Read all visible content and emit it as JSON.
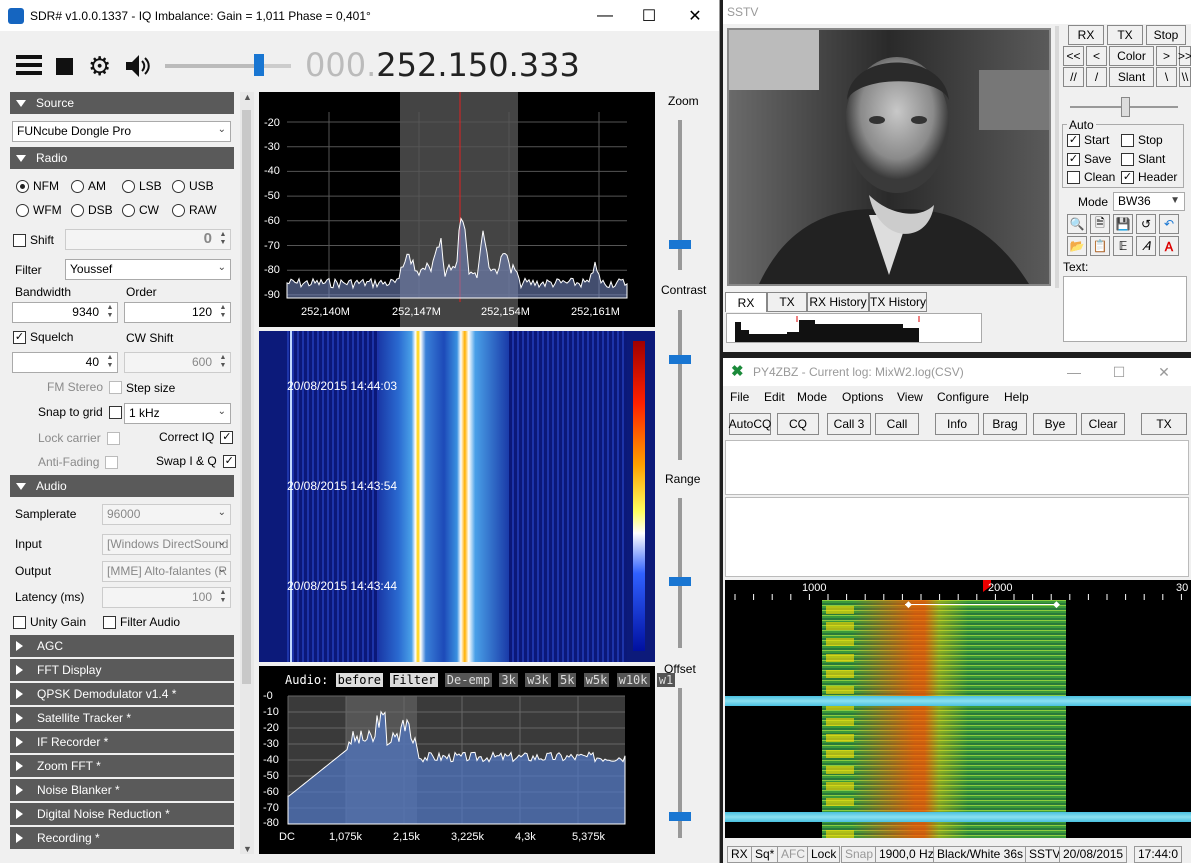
{
  "sdr": {
    "title": "SDR# v1.0.0.1337 - IQ Imbalance: Gain = 1,011 Phase = 0,401°",
    "frequency_dim": "000.",
    "frequency": "252.150.333",
    "source_header": "Source",
    "source_device": "FUNcube Dongle Pro",
    "radio_header": "Radio",
    "modes": [
      "NFM",
      "AM",
      "LSB",
      "USB",
      "WFM",
      "DSB",
      "CW",
      "RAW"
    ],
    "selected_mode": "NFM",
    "shift_label": "Shift",
    "shift_value": "0",
    "filter_label": "Filter",
    "filter_value": "Youssef",
    "bandwidth_label": "Bandwidth",
    "bandwidth_value": "9340",
    "order_label": "Order",
    "order_value": "120",
    "squelch_label": "Squelch",
    "squelch_value": "40",
    "cwshift_label": "CW Shift",
    "cwshift_value": "600",
    "fmstereo_label": "FM Stereo",
    "stepsize_label": "Step size",
    "snap_label": "Snap to grid",
    "step_value": "1 kHz",
    "lock_carrier_label": "Lock carrier",
    "correct_iq_label": "Correct IQ",
    "antifading_label": "Anti-Fading",
    "swap_iq_label": "Swap I & Q",
    "audio_header": "Audio",
    "samplerate_label": "Samplerate",
    "samplerate_value": "96000",
    "input_label": "Input",
    "input_value": "[Windows DirectSound",
    "output_label": "Output",
    "output_value": "[MME] Alto-falantes (R",
    "latency_label": "Latency (ms)",
    "latency_value": "100",
    "unity_gain_label": "Unity Gain",
    "filter_audio_label": "Filter Audio",
    "collapsed_panels": [
      "AGC",
      "FFT Display",
      "QPSK Demodulator v1.4 *",
      "Satellite Tracker *",
      "IF Recorder *",
      "Zoom FFT *",
      "Noise Blanker *",
      "Digital Noise Reduction *",
      "Recording *"
    ],
    "spectrum_y_ticks": [
      "-20",
      "-30",
      "-40",
      "-50",
      "-60",
      "-70",
      "-80",
      "-90"
    ],
    "spectrum_x_ticks": [
      "252,140M",
      "252,147M",
      "252,154M",
      "252,161M"
    ],
    "waterfall_times": [
      "20/08/2015 14:44:03",
      "20/08/2015 14:43:54",
      "20/08/2015 14:43:44"
    ],
    "audio_label": "Audio:",
    "audio_buttons": [
      "before",
      "Filter",
      "De-emp",
      "3k",
      "w3k",
      "5k",
      "w5k",
      "w10k",
      "w1"
    ],
    "audio_y_ticks": [
      "-0",
      "-10",
      "-20",
      "-30",
      "-40",
      "-50",
      "-60",
      "-70",
      "-80"
    ],
    "audio_x_ticks": [
      "DC",
      "1,075k",
      "2,15k",
      "3,225k",
      "4,3k",
      "5,375k"
    ],
    "zoom_label": "Zoom",
    "contrast_label": "Contrast",
    "range_label": "Range",
    "offset_label": "Offset"
  },
  "sstv": {
    "title": "SSTV",
    "buttons_row1": [
      "RX",
      "TX",
      "Stop"
    ],
    "buttons_row2": [
      "<<",
      "<",
      "Color",
      ">",
      ">>"
    ],
    "buttons_row3": [
      "//",
      "/",
      "Slant",
      "\\",
      "\\\\"
    ],
    "auto_label": "Auto",
    "start_label": "Start",
    "stop_label": "Stop",
    "save_label": "Save",
    "slant_label": "Slant",
    "clean_label": "Clean",
    "header_label": "Header",
    "mode_label": "Mode",
    "mode_value": "BW36",
    "text_label": "Text:",
    "tabs": [
      "RX",
      "TX",
      "RX History",
      "TX History"
    ]
  },
  "mixw": {
    "title": "PY4ZBZ - Current log: MixW2.log(CSV)",
    "menu": [
      "File",
      "Edit",
      "Mode",
      "Options",
      "View",
      "Configure",
      "Help"
    ],
    "macros": [
      "AutoCQ",
      "CQ",
      "Call 3",
      "Call",
      "Info",
      "Brag",
      "Bye",
      "Clear",
      "TX"
    ],
    "scale": [
      "1000",
      "2000",
      "30"
    ],
    "status": [
      "RX",
      "Sq*",
      "AFC",
      "Lock",
      "Snap",
      "1900,0 Hz",
      "Black/White 36s",
      "SSTV",
      "20/08/2015",
      "17:44:0"
    ]
  },
  "colors": {
    "accent": "#1976d2",
    "panel_header": "#5a5a5a"
  }
}
